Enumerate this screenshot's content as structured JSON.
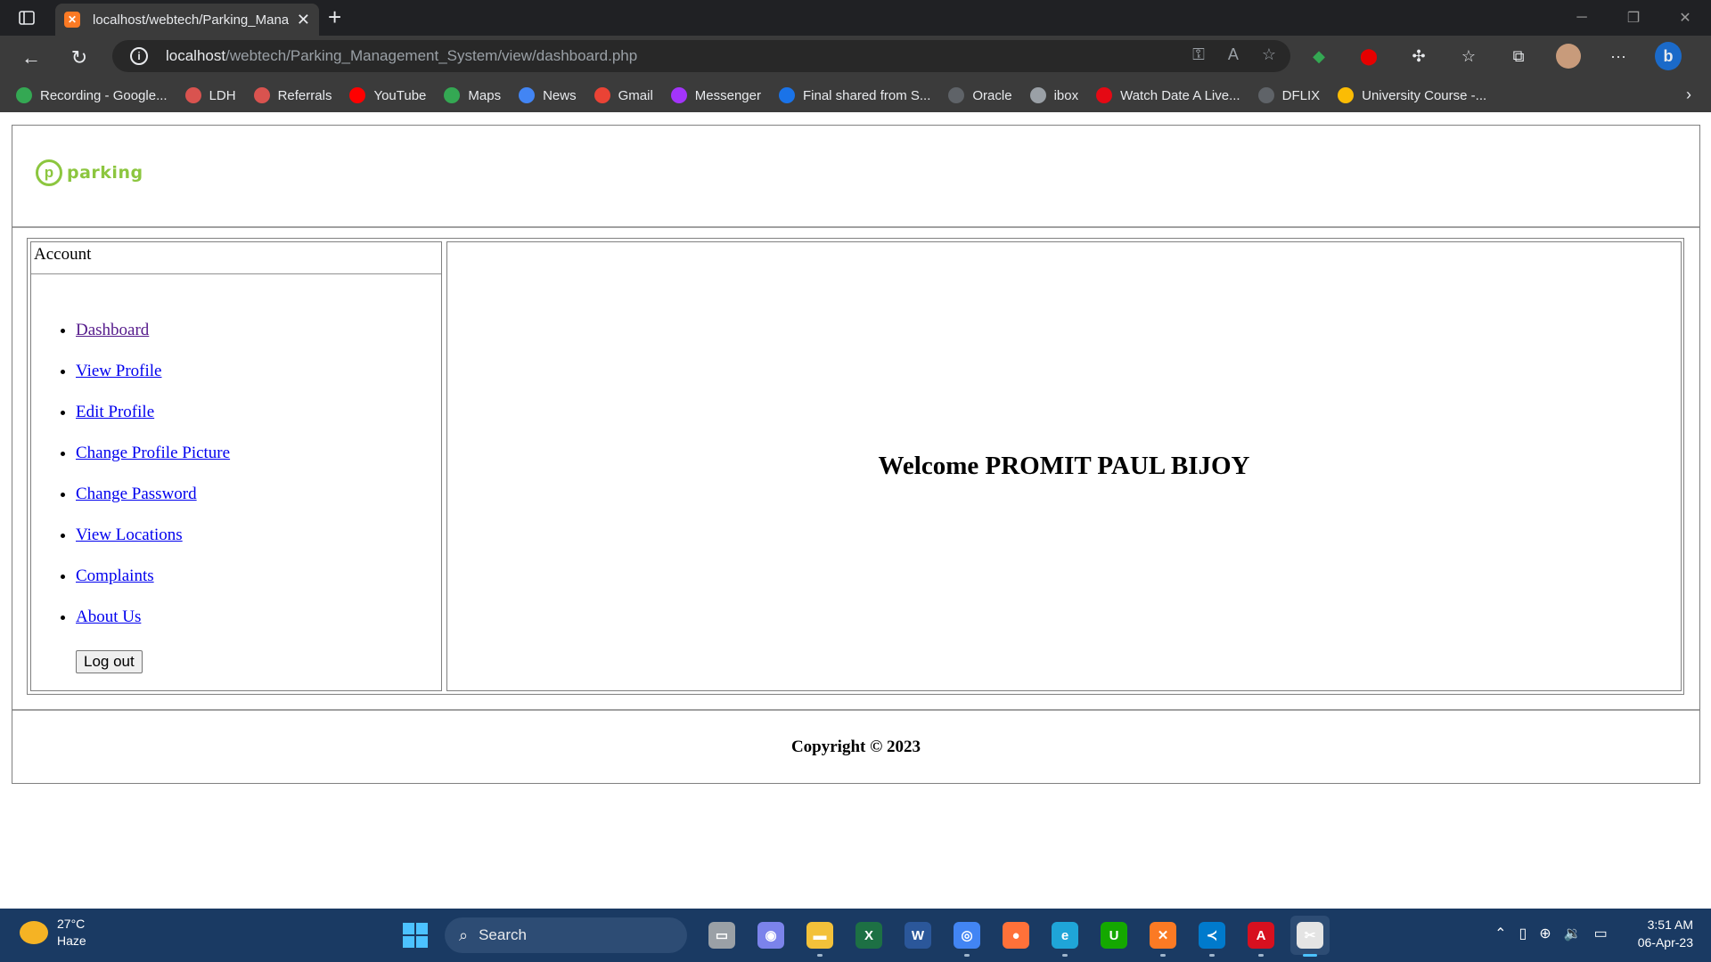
{
  "browser": {
    "tab_title": "localhost/webtech/Parking_Mana",
    "tab_favicon": "xampp-icon",
    "url_host": "localhost",
    "url_path": "/webtech/Parking_Management_System/view/dashboard.php",
    "bookmarks": [
      {
        "label": "Recording - Google...",
        "icon": "google-drive-icon",
        "color": "#34a853"
      },
      {
        "label": "LDH",
        "icon": "ldh-icon",
        "color": "#d9534f"
      },
      {
        "label": "Referrals",
        "icon": "referrals-icon",
        "color": "#d9534f"
      },
      {
        "label": "YouTube",
        "icon": "youtube-icon",
        "color": "#ff0000"
      },
      {
        "label": "Maps",
        "icon": "maps-icon",
        "color": "#34a853"
      },
      {
        "label": "News",
        "icon": "news-icon",
        "color": "#4285f4"
      },
      {
        "label": "Gmail",
        "icon": "gmail-icon",
        "color": "#ea4335"
      },
      {
        "label": "Messenger",
        "icon": "messenger-icon",
        "color": "#a334fa"
      },
      {
        "label": "Final shared from S...",
        "icon": "cloud-icon",
        "color": "#1a73e8"
      },
      {
        "label": "Oracle",
        "icon": "page-icon",
        "color": "#5f6368"
      },
      {
        "label": "ibox",
        "icon": "ibox-icon",
        "color": "#9aa0a6"
      },
      {
        "label": "Watch Date A Live...",
        "icon": "watch-icon",
        "color": "#e50914"
      },
      {
        "label": "DFLIX",
        "icon": "page-icon",
        "color": "#5f6368"
      },
      {
        "label": "University Course -...",
        "icon": "google-drive-icon",
        "color": "#fbbc04"
      }
    ]
  },
  "page": {
    "logo_text": "parking",
    "account_title": "Account",
    "menu": [
      {
        "label": "Dashboard",
        "visited": true
      },
      {
        "label": "View Profile",
        "visited": false
      },
      {
        "label": "Edit Profile",
        "visited": false
      },
      {
        "label": "Change Profile Picture",
        "visited": false
      },
      {
        "label": "Change Password",
        "visited": false
      },
      {
        "label": "View Locations",
        "visited": false
      },
      {
        "label": "Complaints",
        "visited": false
      },
      {
        "label": "About Us",
        "visited": false
      }
    ],
    "logout_label": "Log out",
    "welcome": "Welcome PROMIT PAUL BIJOY",
    "copyright": "Copyright © 2023"
  },
  "taskbar": {
    "temperature": "27°C",
    "weather": "Haze",
    "search_label": "Search",
    "time": "3:51 AM",
    "date": "06-Apr-23",
    "apps": [
      {
        "name": "task-view-icon",
        "color": "#9aa0a6",
        "glyph": "▭",
        "running": false
      },
      {
        "name": "teams-chat-icon",
        "color": "#7b83eb",
        "glyph": "◉",
        "running": false
      },
      {
        "name": "file-explorer-icon",
        "color": "#f3c13a",
        "glyph": "▬",
        "running": true
      },
      {
        "name": "excel-icon",
        "color": "#1d7044",
        "glyph": "X",
        "running": false
      },
      {
        "name": "word-icon",
        "color": "#2b579a",
        "glyph": "W",
        "running": false
      },
      {
        "name": "chrome-icon",
        "color": "#4285f4",
        "glyph": "◎",
        "running": true
      },
      {
        "name": "firefox-icon",
        "color": "#ff7139",
        "glyph": "●",
        "running": false
      },
      {
        "name": "edge-icon",
        "color": "#1fa5d8",
        "glyph": "e",
        "running": true
      },
      {
        "name": "upwork-icon",
        "color": "#14a800",
        "glyph": "U",
        "running": false
      },
      {
        "name": "xampp-icon",
        "color": "#fb7a24",
        "glyph": "✕",
        "running": true
      },
      {
        "name": "vscode-icon",
        "color": "#007acc",
        "glyph": "≺",
        "running": true
      },
      {
        "name": "acrobat-icon",
        "color": "#d7101f",
        "glyph": "A",
        "running": true
      },
      {
        "name": "snipping-tool-icon",
        "color": "#e4e4e4",
        "glyph": "✂",
        "running": true,
        "active": true
      }
    ]
  }
}
